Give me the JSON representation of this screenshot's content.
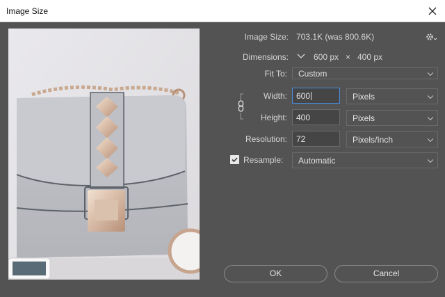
{
  "window": {
    "title": "Image Size"
  },
  "info": {
    "image_size_label": "Image Size:",
    "image_size_value": "703.1K (was 800.6K)",
    "dimensions_label": "Dimensions:",
    "dimensions_width": "600 px",
    "dimensions_times": "×",
    "dimensions_height": "400 px"
  },
  "fit_to": {
    "label": "Fit To:",
    "value": "Custom"
  },
  "width": {
    "label": "Width:",
    "value": "600",
    "unit": "Pixels"
  },
  "height": {
    "label": "Height:",
    "value": "400",
    "unit": "Pixels"
  },
  "resolution": {
    "label": "Resolution:",
    "value": "72",
    "unit": "Pixels/Inch"
  },
  "resample": {
    "label": "Resample:",
    "checked": true,
    "value": "Automatic"
  },
  "buttons": {
    "ok": "OK",
    "cancel": "Cancel"
  },
  "colors": {
    "dialog_bg": "#535353",
    "field_bg": "#454545",
    "focus_border": "#4a8ee0"
  },
  "icons": [
    "close-icon",
    "gear-icon",
    "chevron-down-icon",
    "link-icon",
    "checkbox-checked-icon"
  ]
}
